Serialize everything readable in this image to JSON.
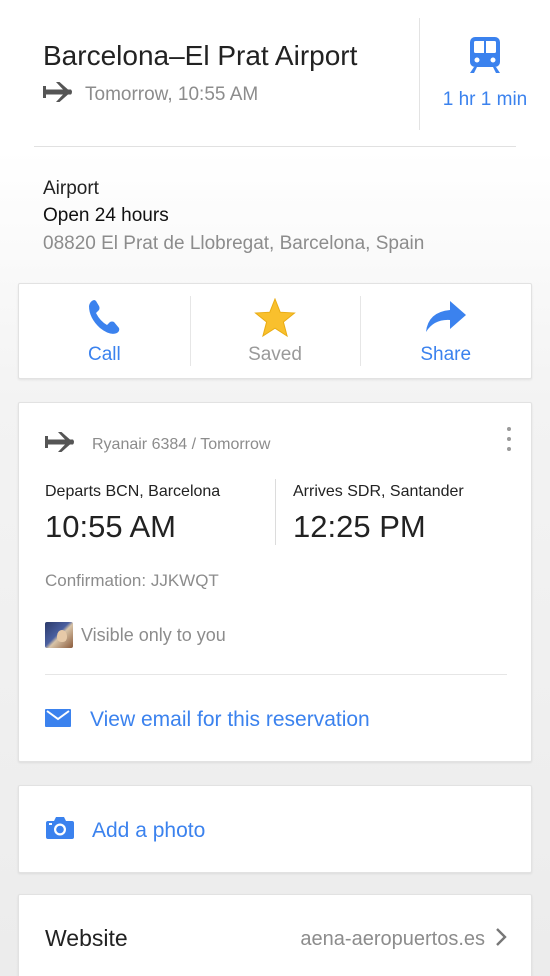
{
  "header": {
    "title": "Barcelona–El Prat Airport",
    "subtitle": "Tomorrow, 10:55 AM",
    "plane_icon": "airplane-icon",
    "transit": {
      "icon": "train-icon",
      "label": "1 hr 1 min",
      "color": "#3b82ee"
    }
  },
  "info": {
    "category": "Airport",
    "hours": "Open 24 hours",
    "address": "08820 El Prat de Llobregat, Barcelona, Spain"
  },
  "actions": [
    {
      "label": "Call",
      "icon": "phone-icon",
      "color": "#3b82ee"
    },
    {
      "label": "Saved",
      "icon": "star-icon",
      "color": "#9a9a9a"
    },
    {
      "label": "Share",
      "icon": "share-arrow-icon",
      "color": "#3b82ee"
    }
  ],
  "flight": {
    "header": "Ryanair 6384 / Tomorrow",
    "departure": {
      "caption": "Departs BCN, Barcelona",
      "time": "10:55 AM"
    },
    "arrival": {
      "caption": "Arrives SDR, Santander",
      "time": "12:25 PM"
    },
    "confirmation": "Confirmation: JJKWQT",
    "visibility": "Visible only to you",
    "email_link": "View email for this reservation"
  },
  "photo": {
    "label": "Add a photo",
    "icon": "camera-icon"
  },
  "website": {
    "label": "Website",
    "value": "aena-aeropuertos.es"
  },
  "colors": {
    "accent": "#3b82ee",
    "star": "#f9c02d",
    "muted": "#8c8c8c"
  }
}
